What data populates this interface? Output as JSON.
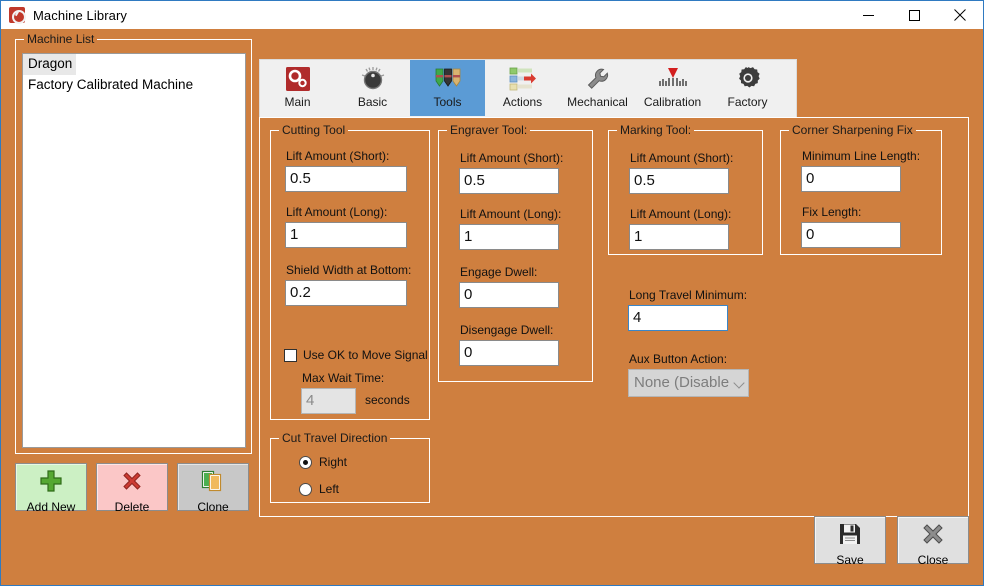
{
  "window": {
    "title": "Machine Library",
    "app_icon": "gauge-icon",
    "controls": {
      "minimize": "minimize-icon",
      "maximize": "maximize-icon",
      "close": "close-icon"
    },
    "accent_border": "#2f7ac1",
    "client_background": "#cf7f3f"
  },
  "machine_list": {
    "group_label": "Machine List",
    "items": [
      {
        "label": "Dragon",
        "selected": true
      },
      {
        "label": "Factory Calibrated Machine",
        "selected": false
      }
    ]
  },
  "list_buttons": [
    {
      "label": "Add New",
      "icon": "plus-icon",
      "color": "#ccf0c4"
    },
    {
      "label": "Delete",
      "icon": "cross-icon",
      "color": "#fbc7c7"
    },
    {
      "label": "Clone",
      "icon": "copy-documents-icon",
      "color": "#c8c8c8"
    }
  ],
  "tabs": [
    {
      "label": "Main",
      "icon": "gears-icon",
      "active": false
    },
    {
      "label": "Basic",
      "icon": "knob-icon",
      "active": false
    },
    {
      "label": "Tools",
      "icon": "markers-icon",
      "active": true
    },
    {
      "label": "Actions",
      "icon": "action-list-icon",
      "active": false
    },
    {
      "label": "Mechanical",
      "icon": "wrench-icon",
      "active": false
    },
    {
      "label": "Calibration",
      "icon": "ruler-pointer-icon",
      "active": false
    },
    {
      "label": "Factory",
      "icon": "gear-icon",
      "active": false
    }
  ],
  "tab_accent": "#5b9bd5",
  "cutting_tool": {
    "group_label": "Cutting Tool",
    "lift_short_label": "Lift Amount (Short):",
    "lift_short_value": "0.5",
    "lift_long_label": "Lift Amount (Long):",
    "lift_long_value": "1",
    "shield_width_label": "Shield Width at Bottom:",
    "shield_width_value": "0.2",
    "ok_to_move_label": "Use OK to Move Signal",
    "ok_to_move_checked": false,
    "max_wait_label": "Max Wait Time:",
    "max_wait_value": "4",
    "max_wait_units": "seconds",
    "max_wait_disabled": true
  },
  "cut_travel": {
    "group_label": "Cut Travel Direction",
    "options": [
      {
        "label": "Right",
        "selected": true
      },
      {
        "label": "Left",
        "selected": false
      }
    ]
  },
  "engraver_tool": {
    "group_label": "Engraver Tool:",
    "lift_short_label": "Lift Amount (Short):",
    "lift_short_value": "0.5",
    "lift_long_label": "Lift Amount (Long):",
    "lift_long_value": "1",
    "engage_dwell_label": "Engage Dwell:",
    "engage_dwell_value": "0",
    "disengage_dwell_label": "Disengage Dwell:",
    "disengage_dwell_value": "0"
  },
  "marking_tool": {
    "group_label": "Marking Tool:",
    "lift_short_label": "Lift Amount (Short):",
    "lift_short_value": "0.5",
    "lift_long_label": "Lift Amount (Long):",
    "lift_long_value": "1"
  },
  "misc": {
    "long_travel_label": "Long Travel Minimum:",
    "long_travel_value": "4",
    "long_travel_focused": true,
    "aux_button_label": "Aux Button Action:",
    "aux_button_value": "None (Disable",
    "aux_button_disabled": true
  },
  "corner_fix": {
    "group_label": "Corner Sharpening Fix",
    "min_line_label": "Minimum Line Length:",
    "min_line_value": "0",
    "fix_length_label": "Fix Length:",
    "fix_length_value": "0"
  },
  "footer_buttons": [
    {
      "label": "Save",
      "icon": "floppy-disk-icon"
    },
    {
      "label": "Close",
      "icon": "x-mark-icon"
    }
  ]
}
